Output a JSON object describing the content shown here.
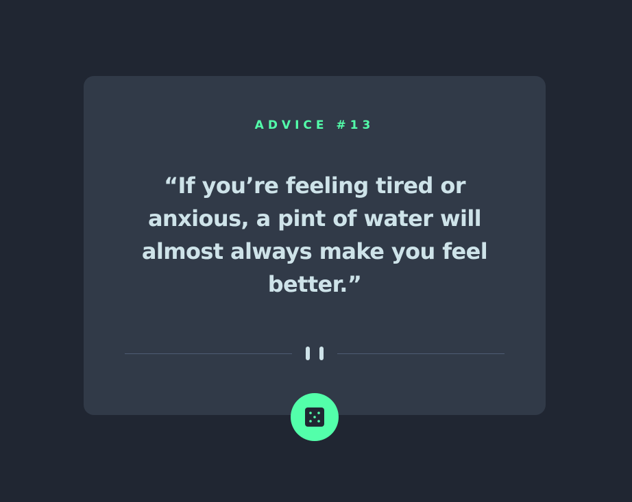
{
  "advice": {
    "heading": "ADVICE #13",
    "quote": "“If you’re feeling tired or anxious, a pint of water will almost always make you feel better.”"
  },
  "icons": {
    "divider": "pause-icon",
    "button": "dice-icon"
  },
  "colors": {
    "background": "#202632",
    "card": "#313a48",
    "accent": "#53ffaa",
    "text": "#cee3e9",
    "divider": "#4f5d74"
  }
}
